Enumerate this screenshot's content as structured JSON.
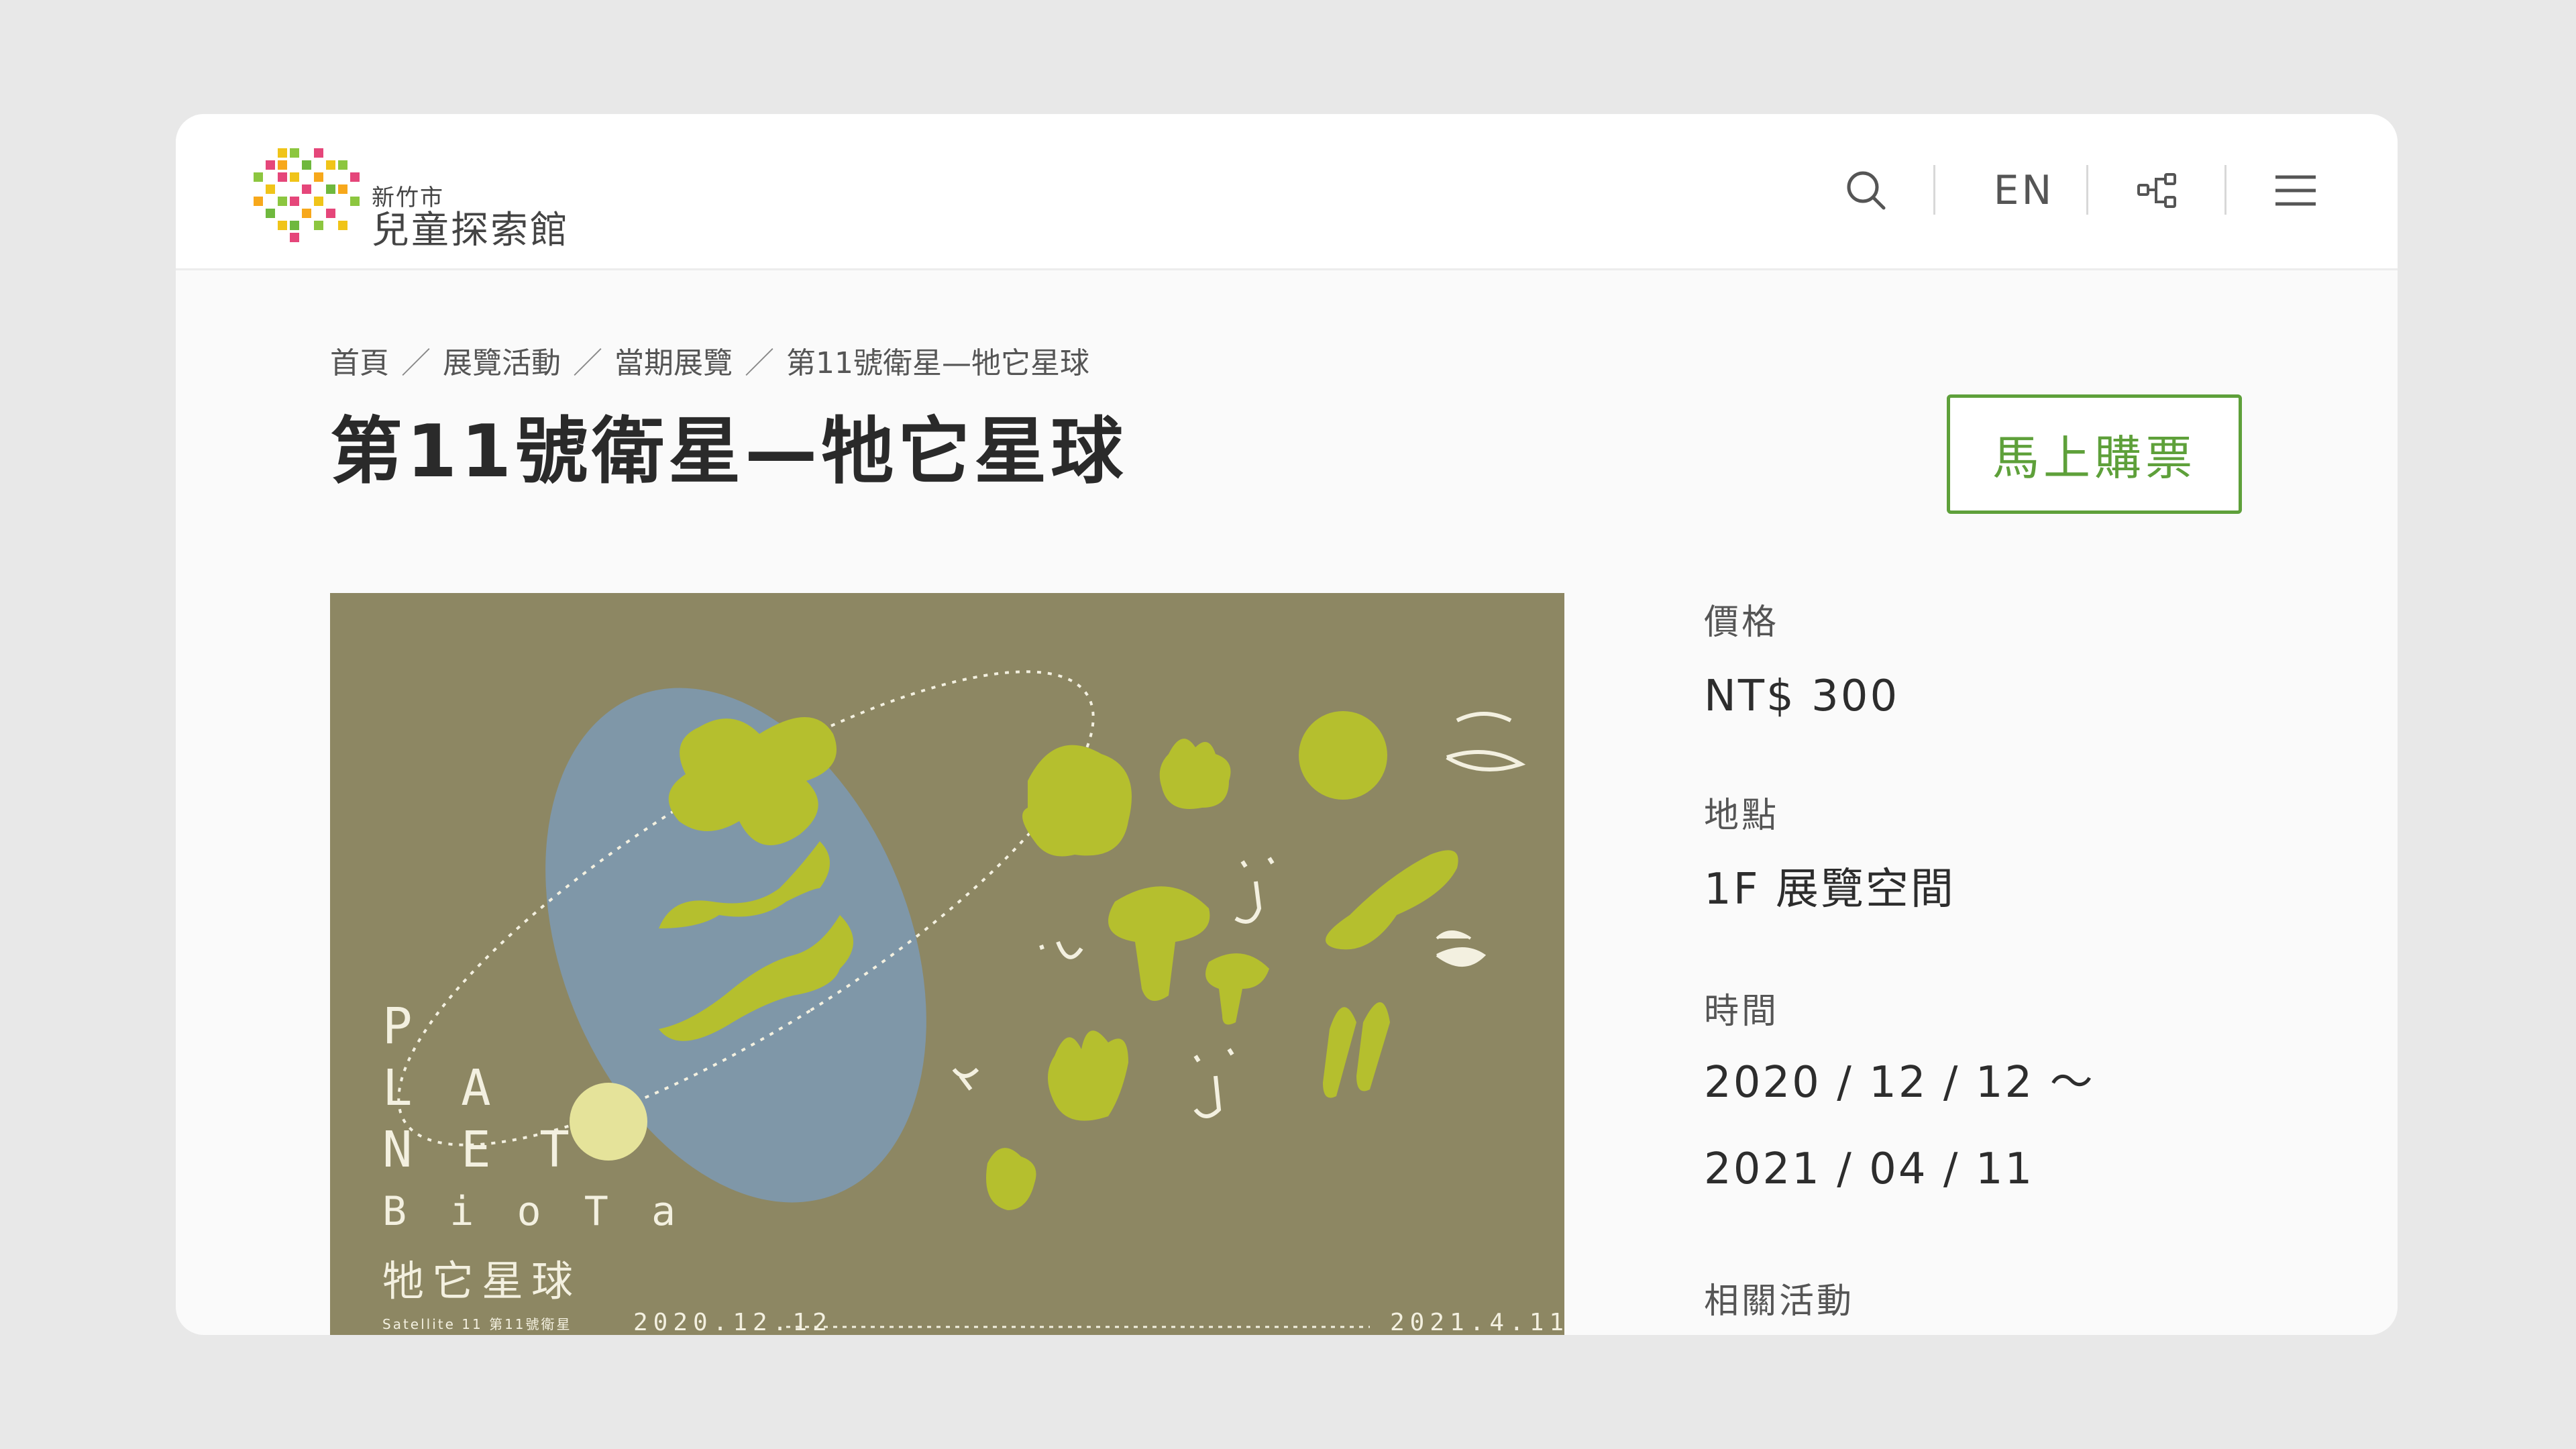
{
  "header": {
    "logo_small": "新竹市",
    "logo_big": "兒童探索館",
    "lang": "EN",
    "icons": [
      "search-icon",
      "sitemap-icon",
      "menu-icon"
    ]
  },
  "breadcrumb": {
    "items": [
      "首頁",
      "展覽活動",
      "當期展覽",
      "第11號衛星—牠它星球"
    ],
    "separator": "／"
  },
  "page": {
    "title": "第11號衛星—牠它星球",
    "buy_label": "馬上購票"
  },
  "poster": {
    "title_lines": [
      "P",
      "L A",
      "N E T",
      "B i o T a"
    ],
    "title_cn": "牠它星球",
    "subtitle": "Satellite 11  第11號衛星",
    "date_start": "2020.12.12",
    "date_end": "2021.4.11"
  },
  "info": {
    "price_label": "價格",
    "price_value": "NT$ 300",
    "location_label": "地點",
    "location_value": "1F 展覽空間",
    "time_label": "時間",
    "time_start": "2020 / 12 / 12 ～",
    "time_end": "2021 / 04 / 11",
    "related_label": "相關活動"
  },
  "colors": {
    "accent_green": "#5ea03a",
    "poster_bg": "#8d8763",
    "poster_blue": "#7f97a8",
    "poster_lime": "#b5bf2e"
  }
}
